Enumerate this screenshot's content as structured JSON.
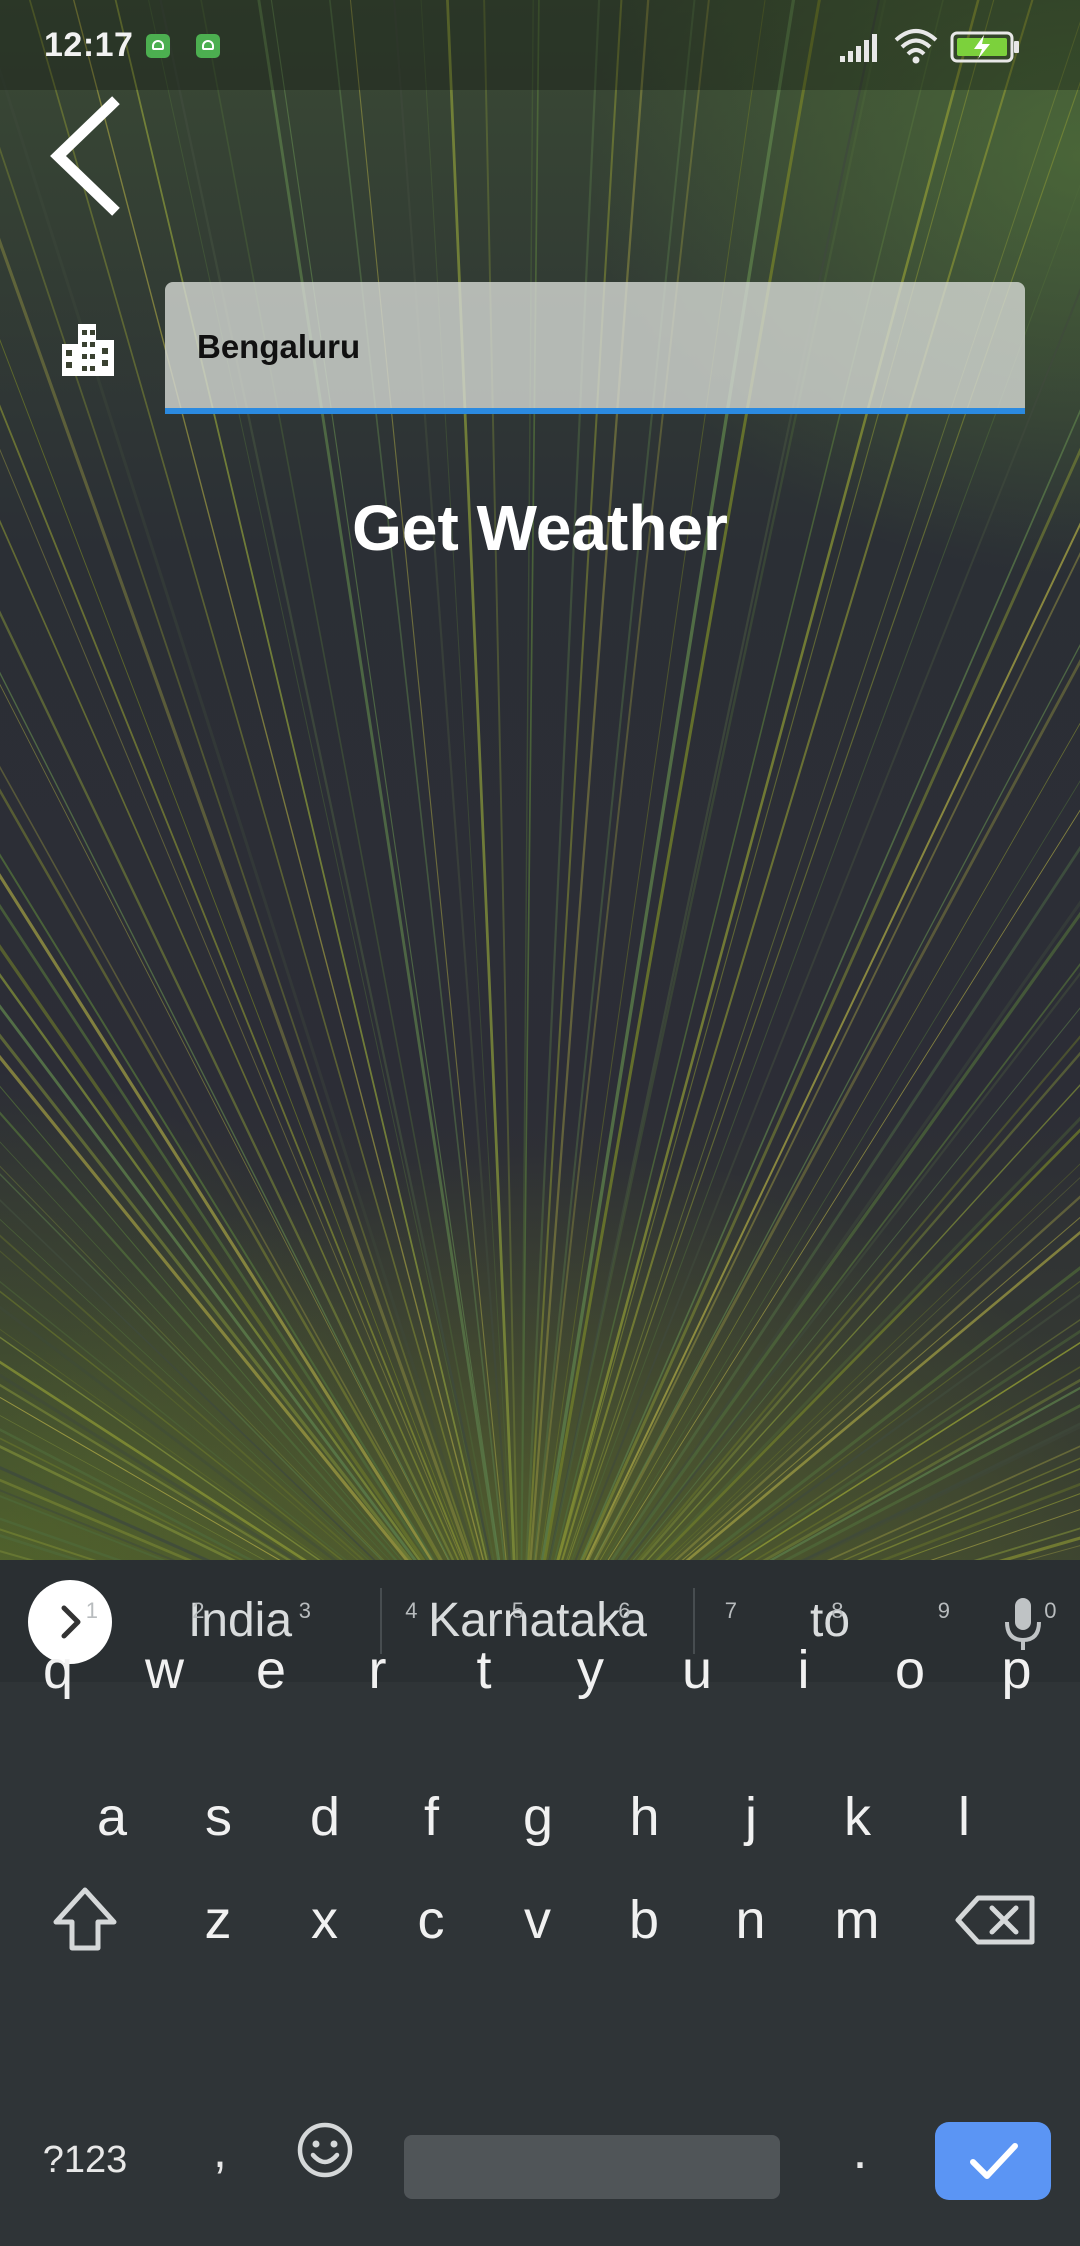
{
  "status_bar": {
    "time": "12:17",
    "icons": [
      "notification-app-icon",
      "notification-app-icon",
      "signal-icon",
      "wifi-icon",
      "battery-charging-icon"
    ]
  },
  "toolbar": {
    "back_icon": "chevron-left-icon"
  },
  "form": {
    "city_icon": "city-buildings-icon",
    "city_value": "Bengaluru",
    "field_underline_color": "#2b8ae0",
    "submit_label": "Get Weather"
  },
  "keyboard": {
    "suggestions": [
      "India",
      "Karnataka",
      "to"
    ],
    "row1": [
      {
        "char": "q",
        "hint": "1"
      },
      {
        "char": "w",
        "hint": "2"
      },
      {
        "char": "e",
        "hint": "3"
      },
      {
        "char": "r",
        "hint": "4"
      },
      {
        "char": "t",
        "hint": "5"
      },
      {
        "char": "y",
        "hint": "6"
      },
      {
        "char": "u",
        "hint": "7"
      },
      {
        "char": "i",
        "hint": "8"
      },
      {
        "char": "o",
        "hint": "9"
      },
      {
        "char": "p",
        "hint": "0"
      }
    ],
    "row2": [
      "a",
      "s",
      "d",
      "f",
      "g",
      "h",
      "j",
      "k",
      "l"
    ],
    "row3": [
      "z",
      "x",
      "c",
      "v",
      "b",
      "n",
      "m"
    ],
    "symbols_label": "?123",
    "comma_label": ",",
    "period_label": ".",
    "enter_color": "#5b95f4"
  }
}
